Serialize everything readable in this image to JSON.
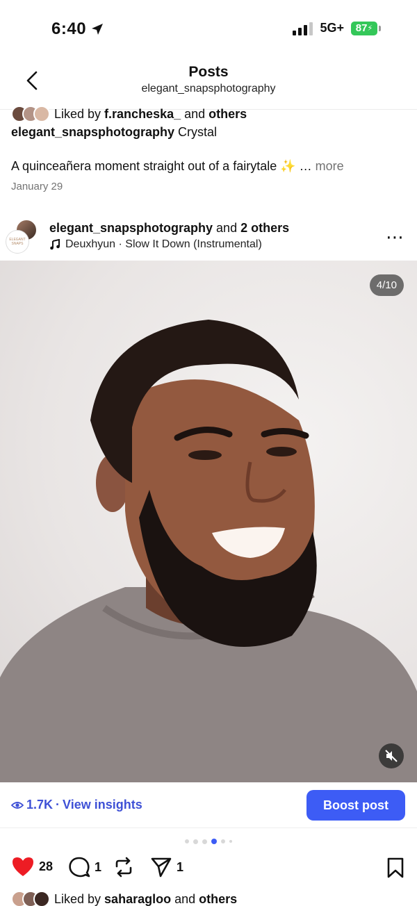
{
  "status_bar": {
    "time": "6:40",
    "network": "5G+",
    "battery": "87"
  },
  "header": {
    "title": "Posts",
    "subtitle": "elegant_snapsphotography"
  },
  "previous_post": {
    "liked_prefix": "Liked by ",
    "liked_user": "f.rancheska_",
    "liked_and": " and ",
    "liked_others": "others",
    "caption_user": "elegant_snapsphotography",
    "caption_text": " Crystal",
    "caption_line": "A quinceañera moment straight out of a fairytale ✨",
    "ellipsis": "… ",
    "more": "more",
    "date": "January 29"
  },
  "post": {
    "author": "elegant_snapsphotography",
    "and_text": " and ",
    "others": "2 others",
    "music": "Deuxhyun · Slow It Down (Instrumental)",
    "more_icon": "⋯",
    "counter": "4/10",
    "avatar_text": "ELEGANT SNAPS"
  },
  "insights": {
    "views": "1.7K",
    "separator": " · ",
    "link": "View insights",
    "boost": "Boost post"
  },
  "carousel": {
    "total_visible_dots": 6,
    "active_index": 3
  },
  "actions": {
    "likes": "28",
    "comments": "1",
    "shares": "1"
  },
  "liked_by": {
    "prefix": "Liked by ",
    "user": "saharagloo",
    "and": " and ",
    "others": "others"
  },
  "colors": {
    "accent": "#3d5cf5",
    "like": "#ed1c24",
    "battery": "#34c759"
  }
}
